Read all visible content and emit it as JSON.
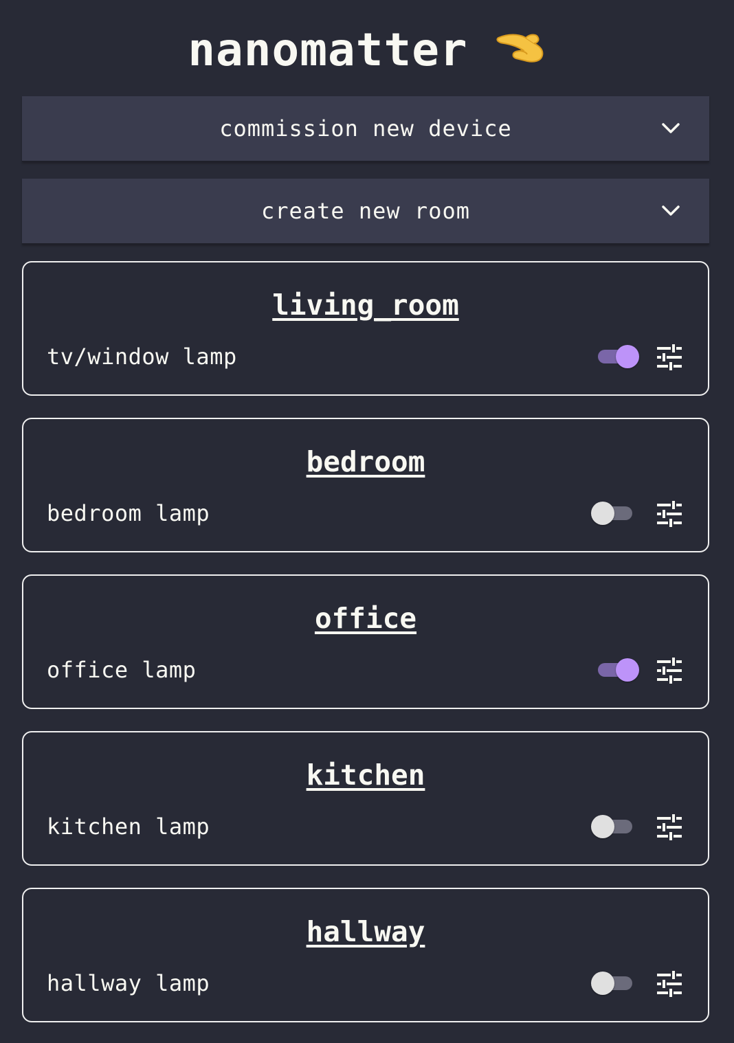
{
  "header": {
    "title": "nanomatter",
    "icon": "pinching-hand-icon"
  },
  "accordions": [
    {
      "label": "commission new device",
      "icon": "chevron-down-icon"
    },
    {
      "label": "create new room",
      "icon": "chevron-down-icon"
    }
  ],
  "rooms": [
    {
      "name": "living_room",
      "device": "tv/window lamp",
      "on": true
    },
    {
      "name": "bedroom",
      "device": "bedroom lamp",
      "on": false
    },
    {
      "name": "office",
      "device": "office lamp",
      "on": true
    },
    {
      "name": "kitchen",
      "device": "kitchen lamp",
      "on": false
    },
    {
      "name": "hallway",
      "device": "hallway lamp",
      "on": false
    }
  ],
  "colors": {
    "background": "#282a36",
    "accordion": "#3a3c4e",
    "toggle_on_knob": "#bd93f9",
    "toggle_on_track": "#7a66a8",
    "toggle_off_knob": "#e0e0e0",
    "toggle_off_track": "#6b6b7b"
  }
}
